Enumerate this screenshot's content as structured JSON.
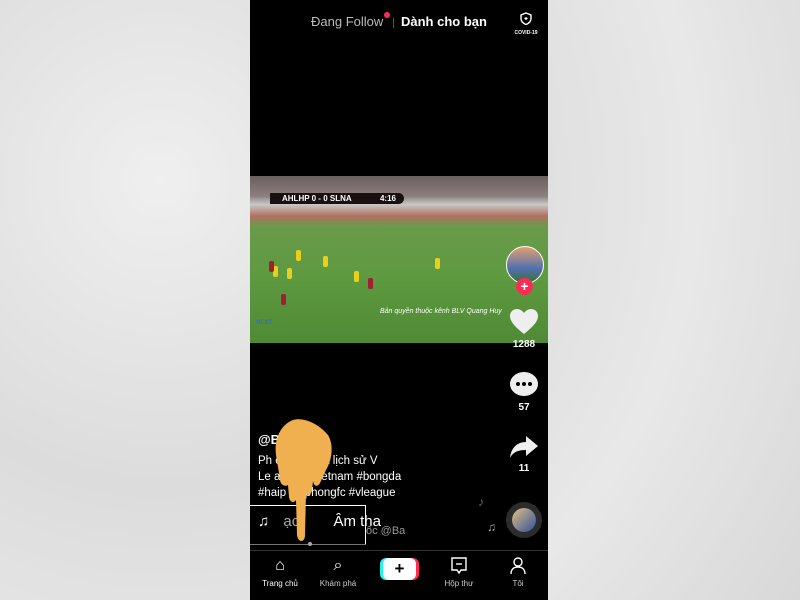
{
  "header": {
    "following_tab": "Đang Follow",
    "for_you_tab": "Dành cho bạn",
    "covid_label": "COVID-19"
  },
  "video": {
    "scoreboard": "AHLHP 0 - 0 SLNA",
    "clock": "4:16",
    "watermark": "Bản quyền thuộc kênh BLV Quang Huy",
    "logo": "NEXT"
  },
  "actions": {
    "likes": "1288",
    "comments": "57",
    "shares": "11"
  },
  "post": {
    "username": "@B      ue",
    "line1": "Ph              o mắt nhất lịch sử V",
    "line2": "Le              andro #vietnam #bongda",
    "line3": "#haip           haiphongfc #vleague",
    "music_prefix": "ạc",
    "music_title": "Âm tha",
    "music_rest": "ốc   @Ba"
  },
  "nav": {
    "home": "Trang chủ",
    "discover": "Khám phá",
    "create": "+",
    "inbox": "Hộp thư",
    "profile": "Tôi"
  },
  "colors": {
    "accent": "#fe2c55",
    "cyan": "#25f4ee",
    "hand": "#f0b050"
  }
}
